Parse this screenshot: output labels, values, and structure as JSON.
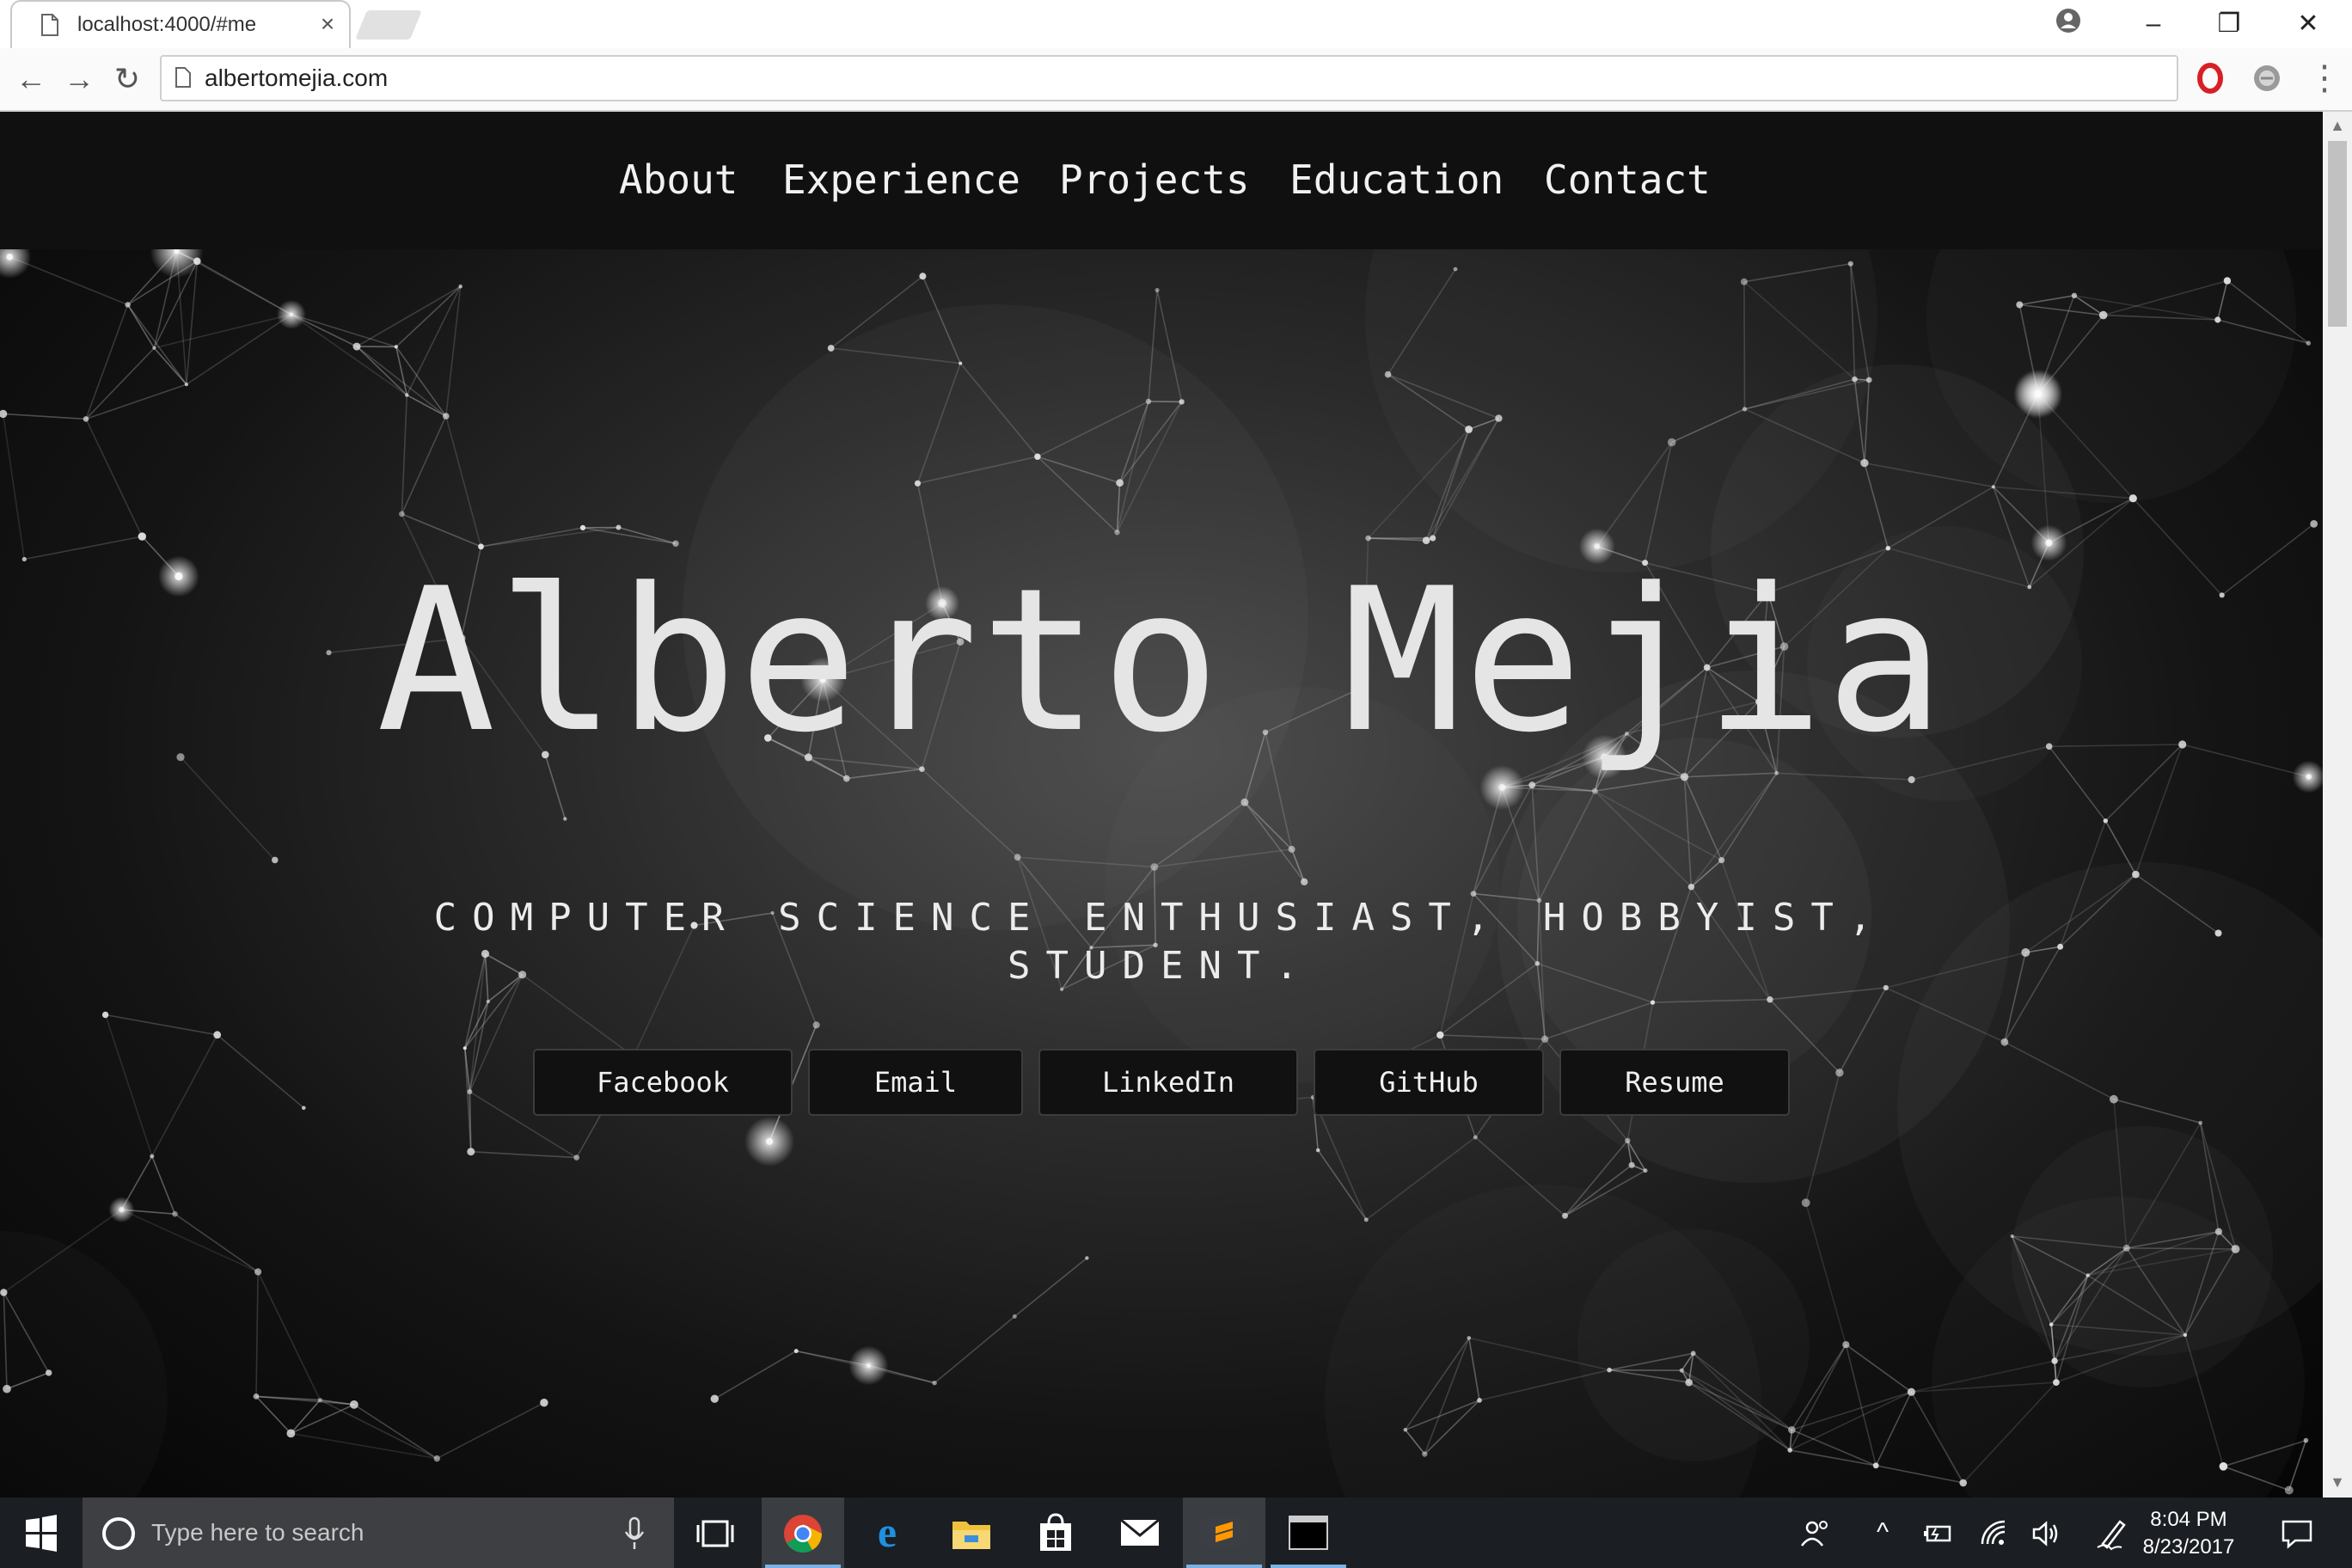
{
  "browser": {
    "tab_title": "localhost:4000/#me",
    "tab_close": "×",
    "url": "albertomejia.com",
    "window_controls": {
      "minimize": "–",
      "restore": "❐",
      "close": "✕"
    },
    "nav_buttons": {
      "back": "←",
      "forward": "→",
      "reload": "↻"
    }
  },
  "site": {
    "nav": [
      "About",
      "Experience",
      "Projects",
      "Education",
      "Contact"
    ],
    "hero_name": "Alberto Mejia",
    "tagline_line1": "COMPUTER SCIENCE ENTHUSIAST, HOBBYIST,",
    "tagline_line2": "STUDENT.",
    "buttons": [
      "Facebook",
      "Email",
      "LinkedIn",
      "GitHub",
      "Resume"
    ]
  },
  "taskbar": {
    "search_placeholder": "Type here to search",
    "apps": [
      "task-view-icon",
      "chrome-icon",
      "edge-icon",
      "file-explorer-icon",
      "store-icon",
      "mail-icon",
      "sublime-text-icon",
      "terminal-icon"
    ],
    "time": "8:04 PM",
    "date": "8/23/2017"
  },
  "colors": {
    "nav_bg": "#101010",
    "text": "#e5e5e5",
    "button_bg": "#111111",
    "taskbar_bg": "#1b1e22"
  }
}
